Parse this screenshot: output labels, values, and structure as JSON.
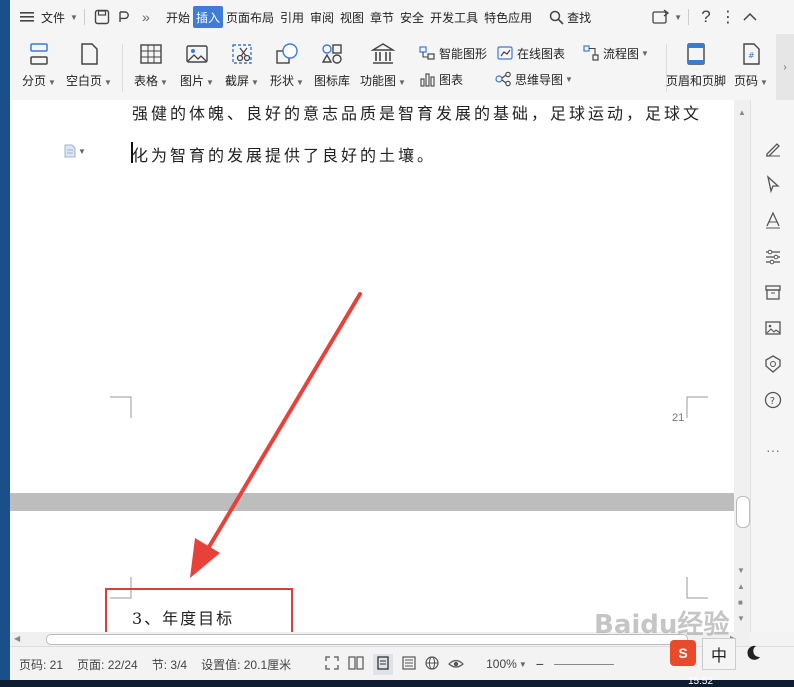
{
  "menu": {
    "file_label": "文件",
    "tabs": [
      "开始",
      "插入",
      "页面布局",
      "引用",
      "审阅",
      "视图",
      "章节",
      "安全",
      "开发工具",
      "特色应用"
    ],
    "active_tab": "插入",
    "search_label": "查找"
  },
  "ribbon": {
    "page_break": "分页",
    "blank_page": "空白页",
    "table": "表格",
    "picture": "图片",
    "screenshot": "截屏",
    "shapes": "形状",
    "icon_lib": "图标库",
    "func_chart": "功能图",
    "smart_art": "智能图形",
    "chart": "图表",
    "online_chart": "在线图表",
    "mind_map": "思维导图",
    "flowchart": "流程图",
    "header_footer": "页眉和页脚",
    "page_num": "页码"
  },
  "document": {
    "line1": "强健的体魄、良好的意志品质是智育发展的基础，足球运动，足球文",
    "line2": "化为智育的发展提供了良好的土壤。",
    "page_number": "21",
    "heading": "3、年度目标"
  },
  "status": {
    "page_code": "页码: 21",
    "page": "页面: 22/24",
    "section": "节: 3/4",
    "setting": "设置值: 20.1厘米",
    "zoom": "100%"
  },
  "ime": {
    "lang": "中"
  },
  "taskbar": {
    "time": "15:52"
  },
  "watermark": "Baidu经验",
  "colors": {
    "accent": "#3f7cd7",
    "arrow": "#e8413a",
    "highlight_box": "#e03c3c"
  }
}
